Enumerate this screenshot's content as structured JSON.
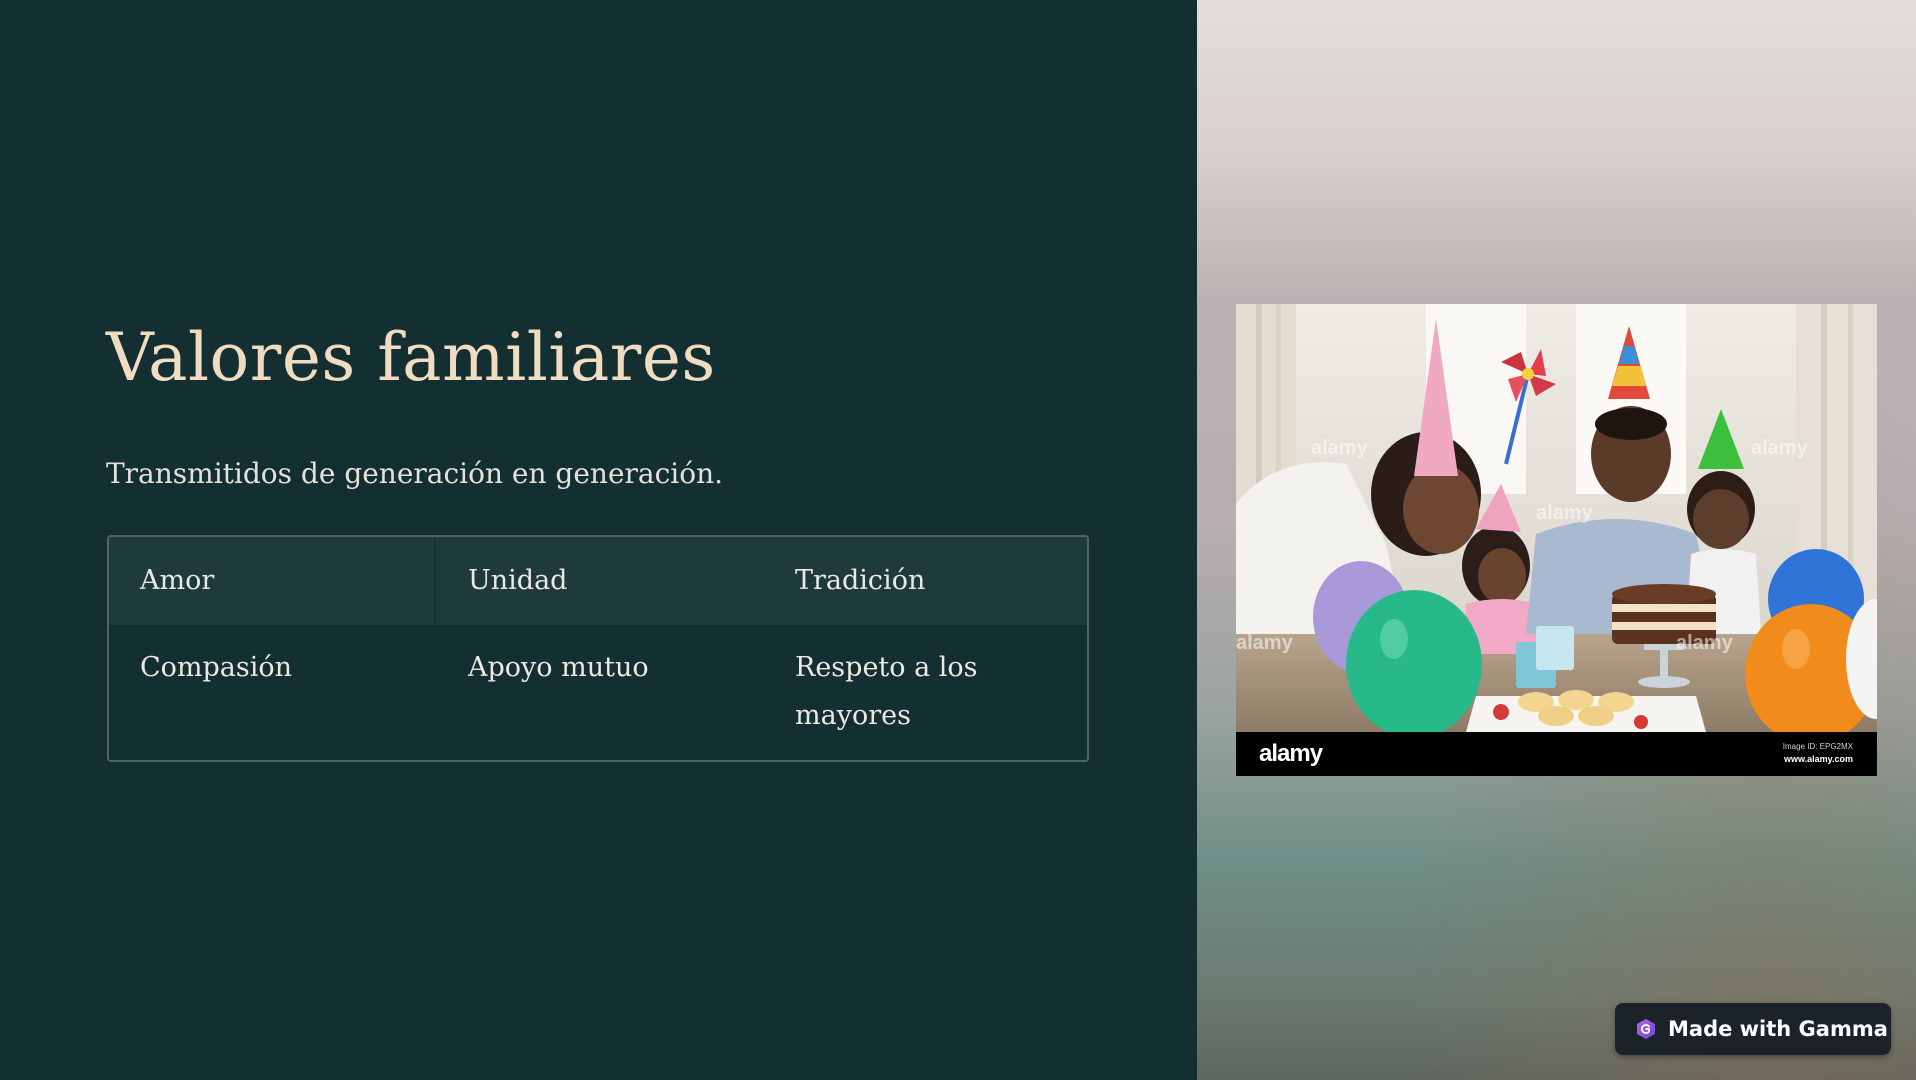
{
  "slide": {
    "title": "Valores familiares",
    "subtitle": "Transmitidos de generación en generación."
  },
  "table": {
    "headers": [
      "Amor",
      "Unidad",
      "Tradición"
    ],
    "rows": [
      [
        "Compasión",
        "Apoyo mutuo",
        "Respeto a los mayores"
      ]
    ]
  },
  "image": {
    "watermark_logo": "alamy",
    "image_id_text": "Image ID: EPG2MX",
    "source_url": "www.alamy.com"
  },
  "badge": {
    "label": "Made with Gamma",
    "icon": "gamma-logo-icon"
  },
  "colors": {
    "background": "#142f31",
    "title": "#f0dcc0",
    "text": "#ece8e2",
    "table_header": "#1e3a3b",
    "table_border": "#4e6566"
  }
}
